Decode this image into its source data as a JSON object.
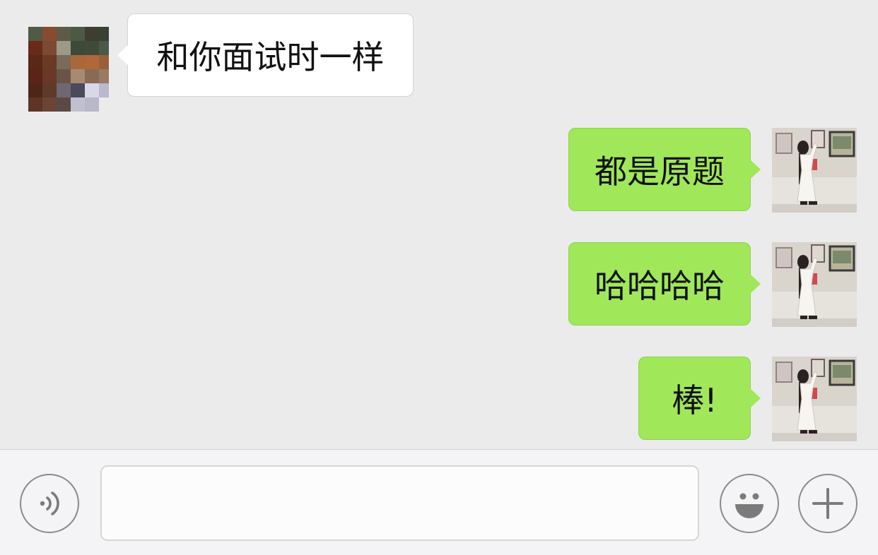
{
  "chat": {
    "messages": [
      {
        "direction": "incoming",
        "text": "和你面试时一样"
      },
      {
        "direction": "outgoing",
        "text": "都是原题"
      },
      {
        "direction": "outgoing",
        "text": "哈哈哈哈"
      },
      {
        "direction": "outgoing",
        "text": "棒!"
      }
    ]
  },
  "composer": {
    "input_value": "",
    "voice_icon": "voice-wave-icon",
    "emoji_icon": "smiley-face-icon",
    "more_icon": "plus-icon"
  },
  "colors": {
    "chat_background": "#ebebeb",
    "incoming_bubble": "#ffffff",
    "outgoing_bubble": "#a0e75a",
    "toolbar_background": "#f4f4f6"
  }
}
